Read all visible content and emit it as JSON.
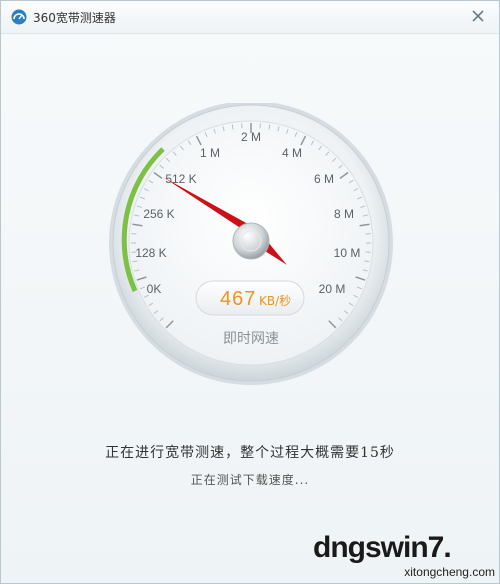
{
  "window": {
    "title": "360宽带测速器"
  },
  "gauge": {
    "tick_labels": [
      "0K",
      "128 K",
      "256 K",
      "512 K",
      "1 M",
      "2 M",
      "4 M",
      "6 M",
      "8 M",
      "10 M",
      "20 M"
    ],
    "readout_value": "467",
    "readout_unit": "KB/秒",
    "caption": "即时网速",
    "colors": {
      "readout": "#f0921e",
      "needle": "#cc1015",
      "progress_arc": "#7dc144"
    }
  },
  "status": {
    "main": "正在进行宽带测速，整个过程大概需要15秒",
    "sub": "正在测试下载速度..."
  },
  "watermark": {
    "text": "dngswin7.",
    "sub": "xitongcheng.com"
  }
}
